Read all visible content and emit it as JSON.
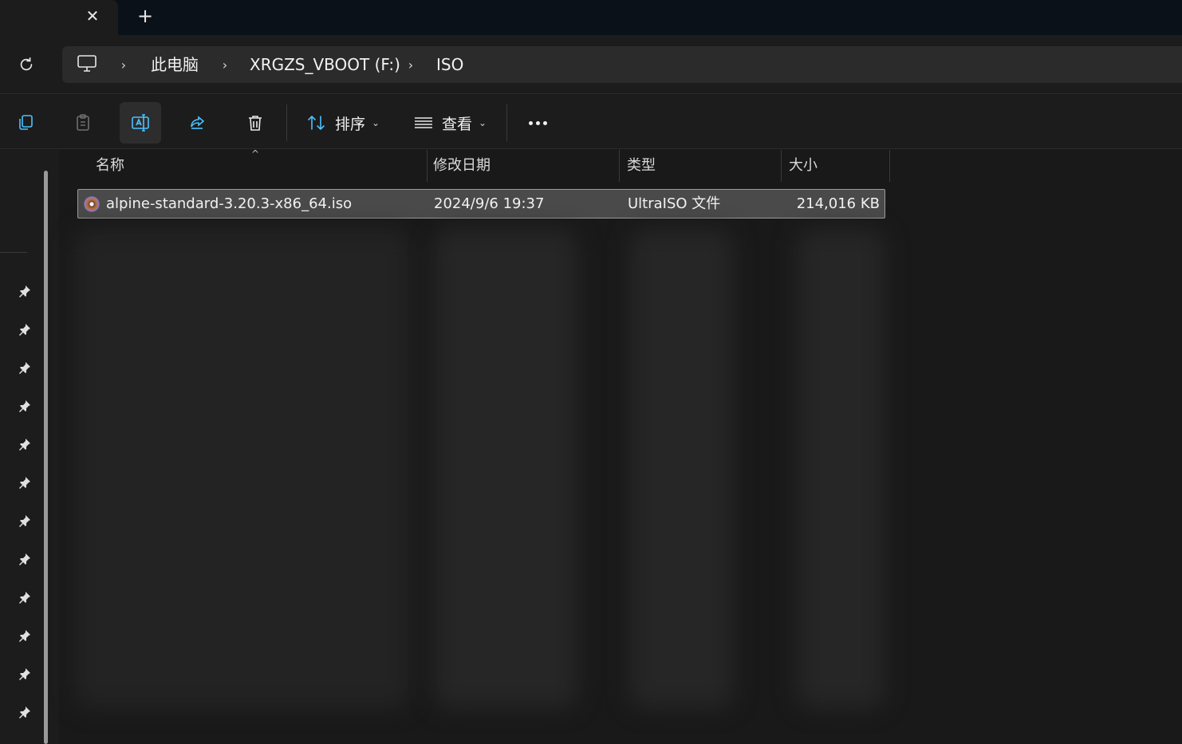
{
  "tabs": {
    "close_glyph": "✕",
    "new_glyph": "+"
  },
  "nav": {
    "breadcrumbs": [
      "此电脑",
      "XRGZS_VBOOT (F:)",
      "ISO"
    ],
    "separator": "›"
  },
  "toolbar": {
    "sort_label": "排序",
    "view_label": "查看",
    "chevron": "⌄"
  },
  "columns": {
    "name": "名称",
    "modified": "修改日期",
    "type": "类型",
    "size": "大小"
  },
  "sort_indicator": "^",
  "files": [
    {
      "name": "alpine-standard-3.20.3-x86_64.iso",
      "modified": "2024/9/6 19:37",
      "type": "UltraISO 文件",
      "size": "214,016 KB"
    }
  ],
  "icons": {
    "copy": "copy-icon",
    "paste": "paste-icon",
    "rename": "rename-icon",
    "share": "share-icon",
    "delete": "delete-icon",
    "sort": "sort-icon",
    "view": "view-icon",
    "more": "more-icon",
    "refresh": "refresh-icon",
    "pc": "computer-icon",
    "pin": "pin-icon"
  },
  "colors": {
    "accent": "#4cc2ff",
    "selection": "#4a4a4a",
    "background": "#191919"
  }
}
